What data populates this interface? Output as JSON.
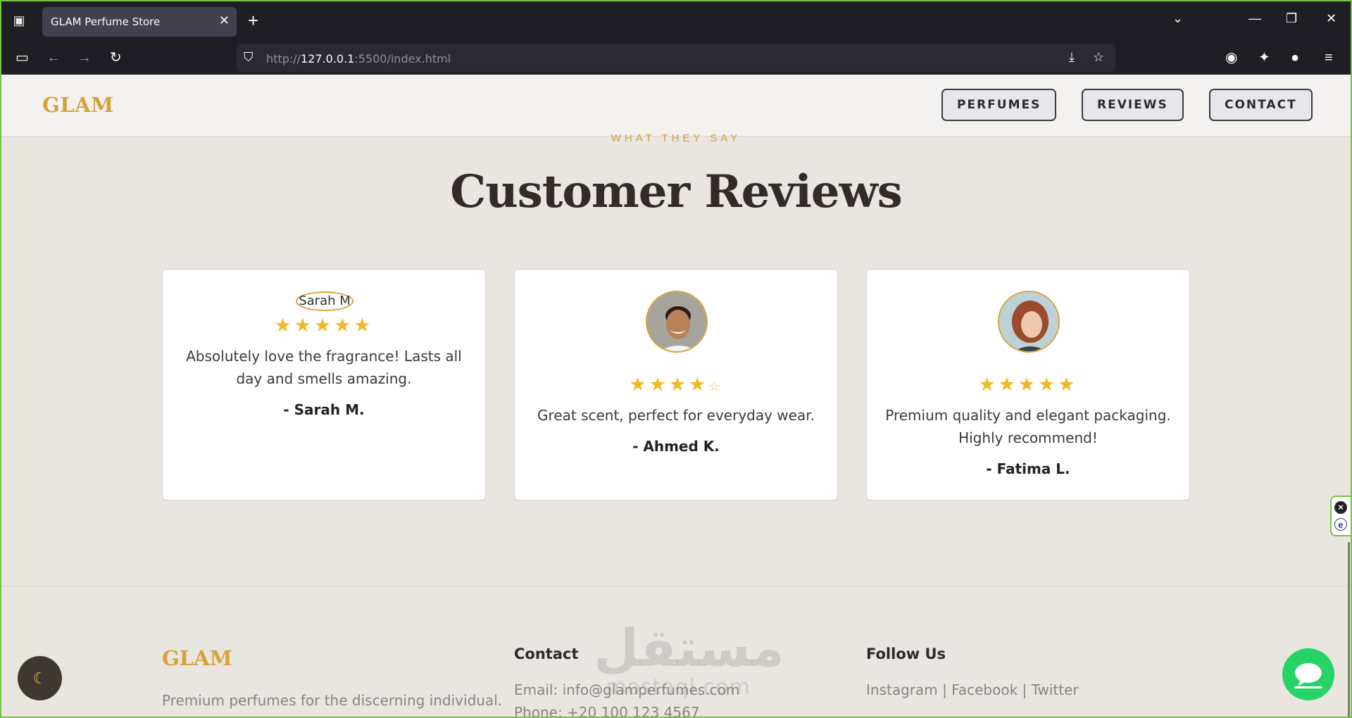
{
  "browser": {
    "tab_title": "GLAM Perfume Store",
    "url_prefix": "http://",
    "url_host": "127.0.0.1",
    "url_rest": ":5500/index.html"
  },
  "header": {
    "logo": "GLAM",
    "nav": [
      "PERFUMES",
      "REVIEWS",
      "CONTACT"
    ]
  },
  "reviews": {
    "eyebrow": "WHAT THEY SAY",
    "title": "Customer Reviews",
    "items": [
      {
        "avatar_alt": "Sarah M",
        "rating": 5,
        "text": "Absolutely love the fragrance! Lasts all day and smells amazing.",
        "author": "- Sarah M."
      },
      {
        "avatar_alt": "Ahmed K",
        "rating": 4,
        "text": "Great scent, perfect for everyday wear.",
        "author": "- Ahmed K."
      },
      {
        "avatar_alt": "Fatima L",
        "rating": 5,
        "text": "Premium quality and elegant packaging. Highly recommend!",
        "author": "- Fatima L."
      }
    ]
  },
  "footer": {
    "logo": "GLAM",
    "tagline": "Premium perfumes for the discerning individual.",
    "contact_heading": "Contact",
    "email": "Email: info@glamperfumes.com",
    "phone": "Phone: +20 100 123 4567",
    "follow_heading": "Follow Us",
    "social": "Instagram | Facebook | Twitter"
  },
  "watermark": {
    "arabic": "مستقل",
    "latin": "mostaql.com"
  },
  "colors": {
    "accent": "#d4a33a",
    "star": "#f2b824",
    "chat": "#25d366",
    "page_bg": "#e9e5e1"
  }
}
